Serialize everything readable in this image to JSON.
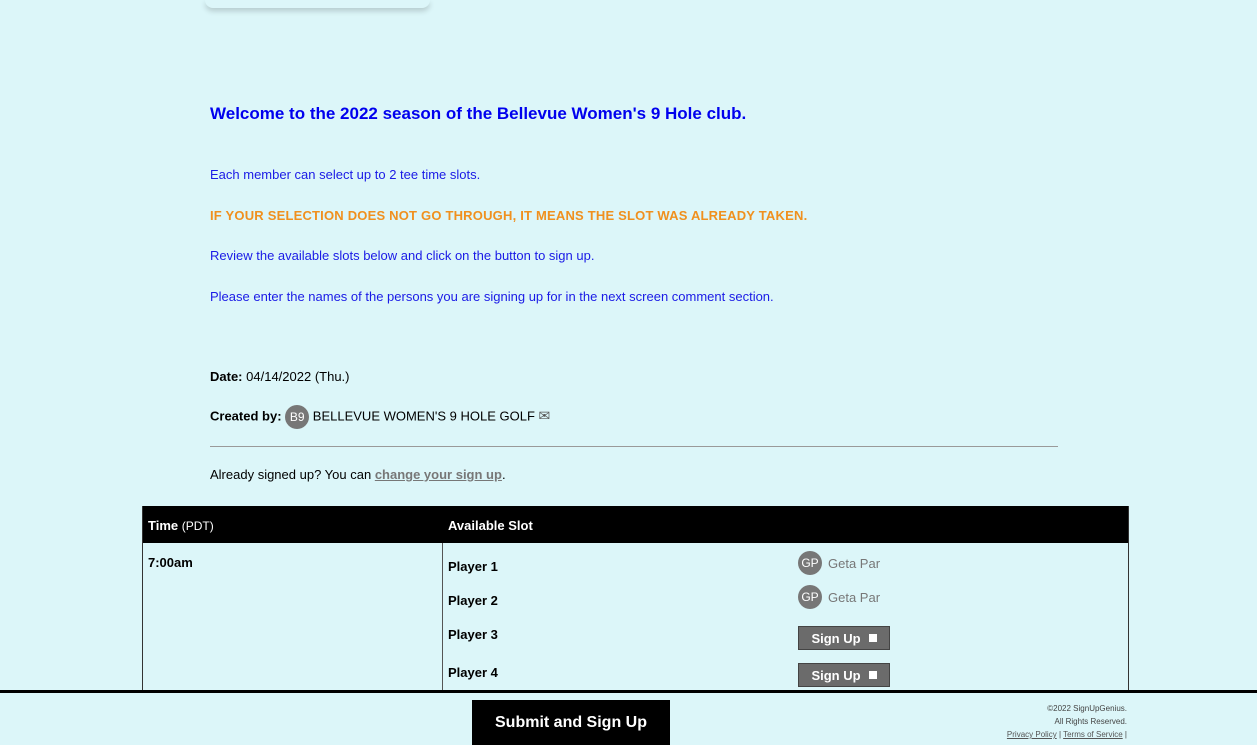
{
  "intro": {
    "welcome": "Welcome to the 2022 season of the Bellevue Women's 9 Hole club.",
    "line1": "Each member can select up to 2 tee time slots.",
    "warning": "IF YOUR SELECTION DOES NOT GO THROUGH, IT MEANS THE SLOT WAS ALREADY TAKEN.",
    "line2": "Review the available slots below and click on the button to sign up.",
    "line3": "Please enter the names of the persons you are signing up for in the next screen comment section."
  },
  "meta": {
    "date_label": "Date:",
    "date_value": "04/14/2022 (Thu.)",
    "created_label": "Created by:",
    "creator_initials": "B9",
    "creator_name": "BELLEVUE WOMEN'S 9 HOLE GOLF",
    "already_text": "Already signed up? You can",
    "change_link": "change your sign up",
    "period": "."
  },
  "table": {
    "header_time": "Time",
    "header_tz": "(PDT)",
    "header_slot": "Available Slot",
    "time": "7:00am",
    "players": [
      {
        "label": "Player 1",
        "status": "filled",
        "initials": "GP",
        "name": "Geta Par"
      },
      {
        "label": "Player 2",
        "status": "filled",
        "initials": "GP",
        "name": "Geta Par"
      },
      {
        "label": "Player 3",
        "status": "open",
        "button": "Sign Up"
      },
      {
        "label": "Player 4",
        "status": "open",
        "button": "Sign Up"
      }
    ]
  },
  "footer": {
    "submit": "Submit and Sign Up",
    "copyright": "©2022 SignUpGenius.",
    "rights": "All Rights Reserved.",
    "privacy": "Privacy Policy",
    "terms": "Terms of Service",
    "sep": "|"
  },
  "colors": {
    "background": "#dcf6f9",
    "text_blue": "#0000ee",
    "warning": "#f0901e",
    "button": "#6b6b6b"
  }
}
